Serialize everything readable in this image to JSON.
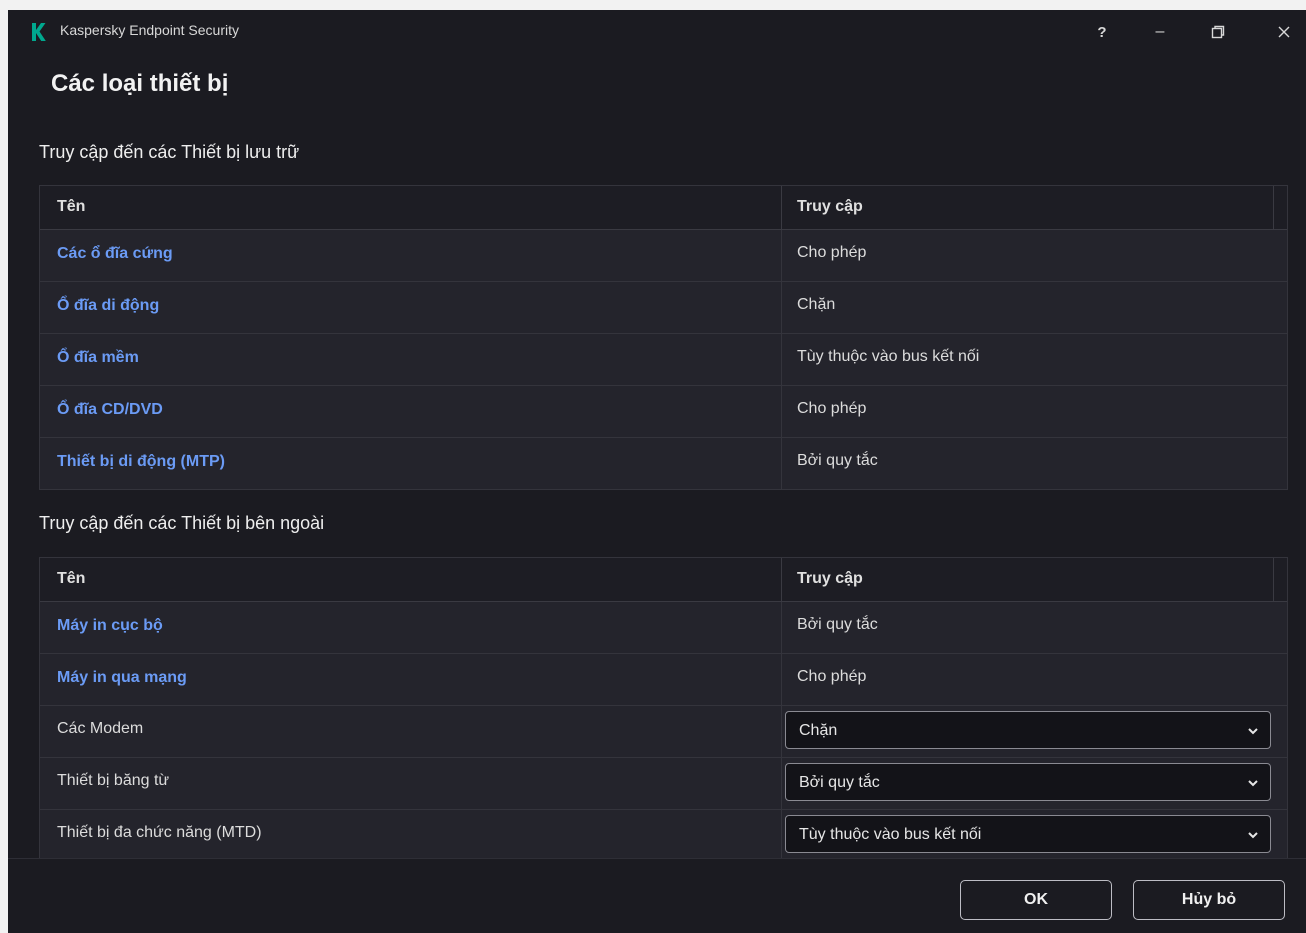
{
  "window": {
    "app_title": "Kaspersky Endpoint Security",
    "help_label": "?",
    "minimize_label": "–",
    "maximize_label": "❐",
    "close_label": "✕",
    "brand_color": "#00a88e"
  },
  "page_title": "Các loại thiết bị",
  "storage": {
    "title": "Truy cập đến các Thiết bị lưu trữ",
    "col_name": "Tên",
    "col_access": "Truy cập",
    "rows": [
      {
        "name": "Các ổ đĩa cứng",
        "access": "Cho phép"
      },
      {
        "name": "Ổ đĩa di động",
        "access": "Chặn"
      },
      {
        "name": "Ổ đĩa mềm",
        "access": "Tùy thuộc vào bus kết nối"
      },
      {
        "name": "Ổ đĩa CD/DVD",
        "access": "Cho phép"
      },
      {
        "name": "Thiết bị di động (MTP)",
        "access": "Bởi quy tắc"
      }
    ]
  },
  "external": {
    "title": "Truy cập đến các Thiết bị bên ngoài",
    "col_name": "Tên",
    "col_access": "Truy cập",
    "rows": [
      {
        "name": "Máy in cục bộ",
        "access": "Bởi quy tắc"
      },
      {
        "name": "Máy in qua mạng",
        "access": "Cho phép"
      },
      {
        "name": "Các Modem",
        "access": "Chặn"
      },
      {
        "name": "Thiết bị băng từ",
        "access": "Bởi quy tắc"
      },
      {
        "name": "Thiết bị đa chức năng (MTD)",
        "access": "Tùy thuộc vào bus kết nối"
      }
    ]
  },
  "footer": {
    "ok_label": "OK",
    "cancel_label": "Hủy bỏ"
  }
}
